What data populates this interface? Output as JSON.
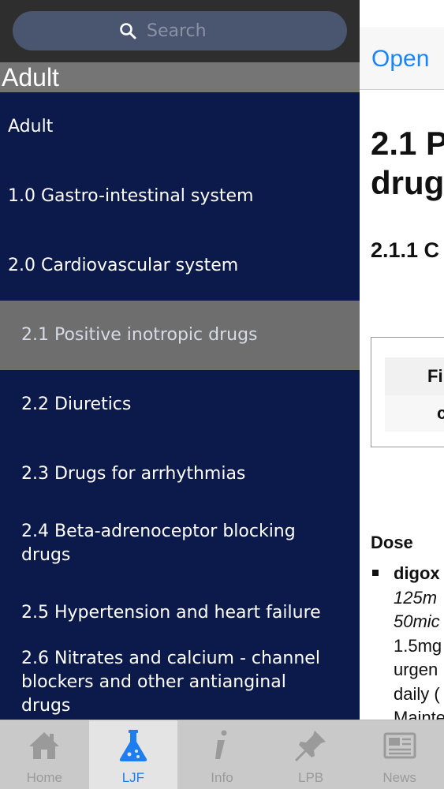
{
  "search": {
    "placeholder": "Search"
  },
  "sidebar": {
    "header": "Adult",
    "items": [
      {
        "label": "Adult"
      },
      {
        "label": "1.0 Gastro-intestinal system"
      },
      {
        "label": "2.0 Cardiovascular system"
      },
      {
        "label": "2.1 Positive inotropic drugs",
        "selected": true
      },
      {
        "label": "2.2 Diuretics"
      },
      {
        "label": "2.3 Drugs for arrhythmias"
      },
      {
        "label": "2.4 Beta-adrenoceptor blocking drugs"
      },
      {
        "label": "2.5 Hypertension and heart failure"
      },
      {
        "label": "2.6 Nitrates and calcium - channel blockers and other antianginal drugs"
      }
    ]
  },
  "detail": {
    "open_label": "Open",
    "title_line1": "2.1 P",
    "title_line2": "drug",
    "subtitle": "2.1.1 C",
    "table_head": "Fi",
    "table_cell": "c",
    "dose_heading": "Dose",
    "dose_lines": [
      "digox",
      "125m",
      "50mic",
      "1.5mg",
      "urgen",
      "daily (",
      "Mainte"
    ]
  },
  "tabs": [
    {
      "label": "Home",
      "icon": "home-icon",
      "active": false
    },
    {
      "label": "LJF",
      "icon": "flask-icon",
      "active": true
    },
    {
      "label": "Info",
      "icon": "info-icon",
      "active": false
    },
    {
      "label": "LPB",
      "icon": "pin-icon",
      "active": false
    },
    {
      "label": "News",
      "icon": "newspaper-icon",
      "active": false
    }
  ],
  "colors": {
    "sidebar_bg": "#0b1a4a",
    "selected_row": "#6e6e6e",
    "accent": "#1e7ef0"
  }
}
